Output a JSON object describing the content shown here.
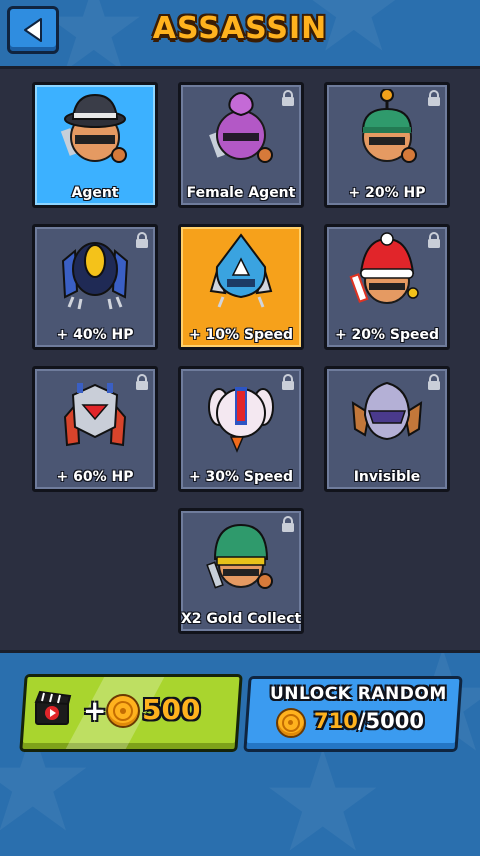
{
  "header": {
    "title": "ASSASSIN",
    "back_icon": "back-arrow-icon"
  },
  "skins": [
    {
      "label": "Agent",
      "state": "selected",
      "locked": false,
      "char": "agent"
    },
    {
      "label": "Female Agent",
      "state": "default",
      "locked": true,
      "char": "female-agent"
    },
    {
      "label": "+ 20% HP",
      "state": "default",
      "locked": true,
      "char": "antenna"
    },
    {
      "label": "+ 40% HP",
      "state": "default",
      "locked": true,
      "char": "robot-yellow"
    },
    {
      "label": "+ 10% Speed",
      "state": "equipped",
      "locked": false,
      "char": "hood-blue"
    },
    {
      "label": "+ 20% Speed",
      "state": "default",
      "locked": true,
      "char": "santa"
    },
    {
      "label": "+ 60% HP",
      "state": "default",
      "locked": true,
      "char": "mech-red"
    },
    {
      "label": "+ 30% Speed",
      "state": "default",
      "locked": true,
      "char": "bunny"
    },
    {
      "label": "Invisible",
      "state": "default",
      "locked": true,
      "char": "invisible"
    },
    {
      "label": "X2 Gold Collect",
      "state": "default",
      "locked": true,
      "char": "green-cap"
    }
  ],
  "watch_ad": {
    "prefix": "+",
    "amount": "500",
    "icon": "video-clapper-icon"
  },
  "unlock_random": {
    "label": "UNLOCK RANDOM",
    "current": "710",
    "separator": "/",
    "cost": "5000"
  },
  "colors": {
    "selected_bg": "#3cb1ff",
    "equipped_bg": "#f6a11b",
    "card_bg": "#4b5673",
    "gold": "#ffb21e"
  }
}
